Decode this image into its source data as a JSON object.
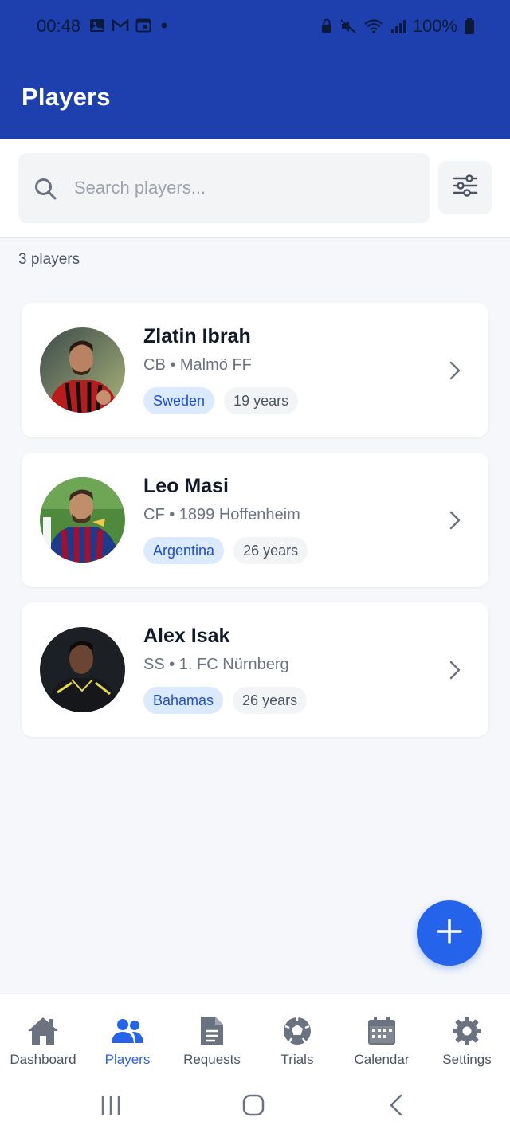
{
  "status_bar": {
    "time": "00:48",
    "battery": "100%"
  },
  "header": {
    "title": "Players"
  },
  "search": {
    "placeholder": "Search players..."
  },
  "summary": {
    "count_label": "3 players"
  },
  "players": [
    {
      "name": "Zlatin Ibrah",
      "position_club": "CB • Malmö FF",
      "country": "Sweden",
      "age": "19 years"
    },
    {
      "name": "Leo Masi",
      "position_club": "CF • 1899 Hoffenheim",
      "country": "Argentina",
      "age": "26 years"
    },
    {
      "name": "Alex Isak",
      "position_club": "SS • 1. FC Nürnberg",
      "country": "Bahamas",
      "age": "26 years"
    }
  ],
  "bottom_nav": {
    "items": [
      {
        "label": "Dashboard",
        "icon": "home-icon"
      },
      {
        "label": "Players",
        "icon": "users-icon"
      },
      {
        "label": "Requests",
        "icon": "document-icon"
      },
      {
        "label": "Trials",
        "icon": "soccer-ball-icon"
      },
      {
        "label": "Calendar",
        "icon": "calendar-icon"
      },
      {
        "label": "Settings",
        "icon": "gear-icon"
      }
    ],
    "active": "Players"
  },
  "colors": {
    "header_bg": "#1e40af",
    "accent": "#2563eb",
    "country_tag_bg": "#dbeafe",
    "country_tag_text": "#1d4ed8"
  }
}
